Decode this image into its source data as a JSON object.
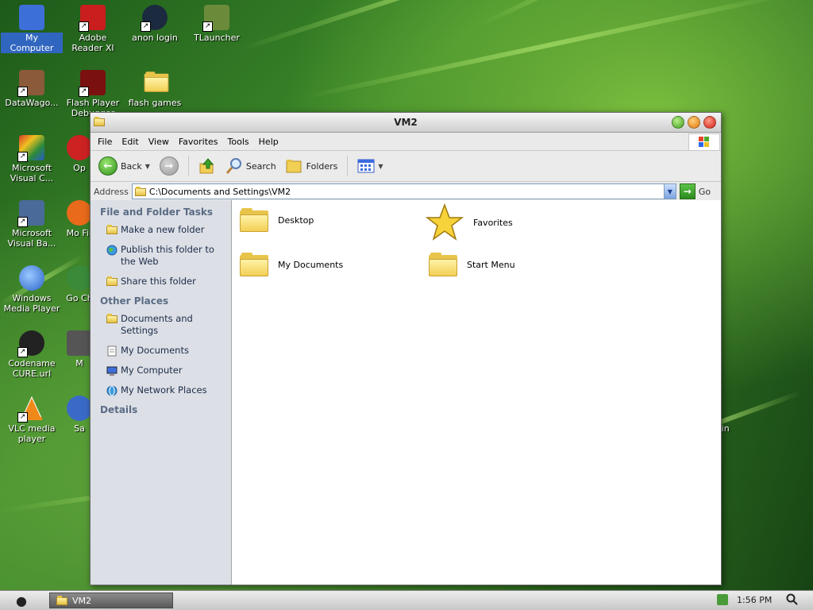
{
  "desktop": {
    "icons": [
      {
        "label": "My Computer",
        "color": "#3d6fd8",
        "shortcut": false,
        "selected": true
      },
      {
        "label": "Adobe Reader XI",
        "color": "#c81e1e",
        "shortcut": true
      },
      {
        "label": "anon login",
        "color": "#1b2a3e",
        "shortcut": true
      },
      {
        "label": "TLauncher",
        "color": "#6b8b3a",
        "shortcut": true
      },
      {
        "label": "DataWago...",
        "color": "#8b5a3a",
        "shortcut": true
      },
      {
        "label": "Flash Player Debugger",
        "color": "#7a1010",
        "shortcut": true
      },
      {
        "label": "flash games",
        "color": "#e8c44a",
        "shortcut": false
      },
      {
        "label": "Microsoft Visual C...",
        "color": "#d43a2a",
        "shortcut": true
      },
      {
        "label": "Microsoft Visual Ba...",
        "color": "#4a6a9a",
        "shortcut": true
      },
      {
        "label": "Windows Media Player",
        "color": "#2a64c8",
        "shortcut": false
      },
      {
        "label": "Codename CURE.url",
        "color": "#222222",
        "shortcut": true
      },
      {
        "label": "VLC media player",
        "color": "#ef8a1a",
        "shortcut": true
      },
      {
        "label": "Op",
        "color": "#cc2222",
        "shortcut": true
      },
      {
        "label": "Mo Fir",
        "color": "#e86a1a",
        "shortcut": true
      },
      {
        "label": "Go Ch",
        "color": "#3a8a3a",
        "shortcut": true
      },
      {
        "label": "M",
        "color": "#555555",
        "shortcut": true
      },
      {
        "label": "Sa",
        "color": "#3a6ac8",
        "shortcut": true
      },
      {
        "label": "Bin",
        "color": "#888888",
        "shortcut": false
      }
    ]
  },
  "window": {
    "title": "VM2",
    "menu": [
      "File",
      "Edit",
      "View",
      "Favorites",
      "Tools",
      "Help"
    ],
    "toolbar": {
      "back_label": "Back",
      "search_label": "Search",
      "folders_label": "Folders"
    },
    "address": {
      "label": "Address",
      "value": "C:\\Documents and Settings\\VM2",
      "go_label": "Go"
    },
    "tasks": {
      "file_folder_heading": "File and Folder Tasks",
      "file_folder_items": [
        "Make a new folder",
        "Publish this folder to the Web",
        "Share this folder"
      ],
      "other_places_heading": "Other Places",
      "other_places_items": [
        "Documents and Settings",
        "My Documents",
        "My Computer",
        "My Network Places"
      ],
      "details_heading": "Details"
    },
    "items": [
      "Desktop",
      "Favorites",
      "My Documents",
      "Start Menu"
    ]
  },
  "taskbar": {
    "task_label": "VM2",
    "clock": "1:56 PM"
  },
  "colors": {
    "accent": "#3166c0",
    "taskpane_heading": "#5b6b85"
  }
}
